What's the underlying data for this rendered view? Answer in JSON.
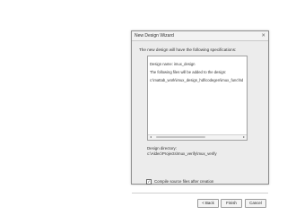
{
  "window": {
    "title": "New Design Wizard",
    "close_glyph": "✕"
  },
  "intro": "The new design will have the following specifications:",
  "specs": {
    "design_name": "Design name: imux_design",
    "files_intro": "The following files will be added to the design:",
    "file_path": "c:\\mattab_work\\imux_design_hdl\\codegen\\imux_func\\hdlsrc\\imux_d..."
  },
  "scrollbar": {
    "left_arrow": "◂",
    "right_arrow": "▸"
  },
  "directory": {
    "label": "Design directory:",
    "value": "c:\\Aldec\\Projects\\mux_verify\\mux_verify"
  },
  "compile_checkbox": {
    "checked": true,
    "mark": "✓",
    "label": "Compile source files after creation"
  },
  "buttons": {
    "back": "< Back",
    "finish": "Finish",
    "cancel": "Cancel"
  }
}
